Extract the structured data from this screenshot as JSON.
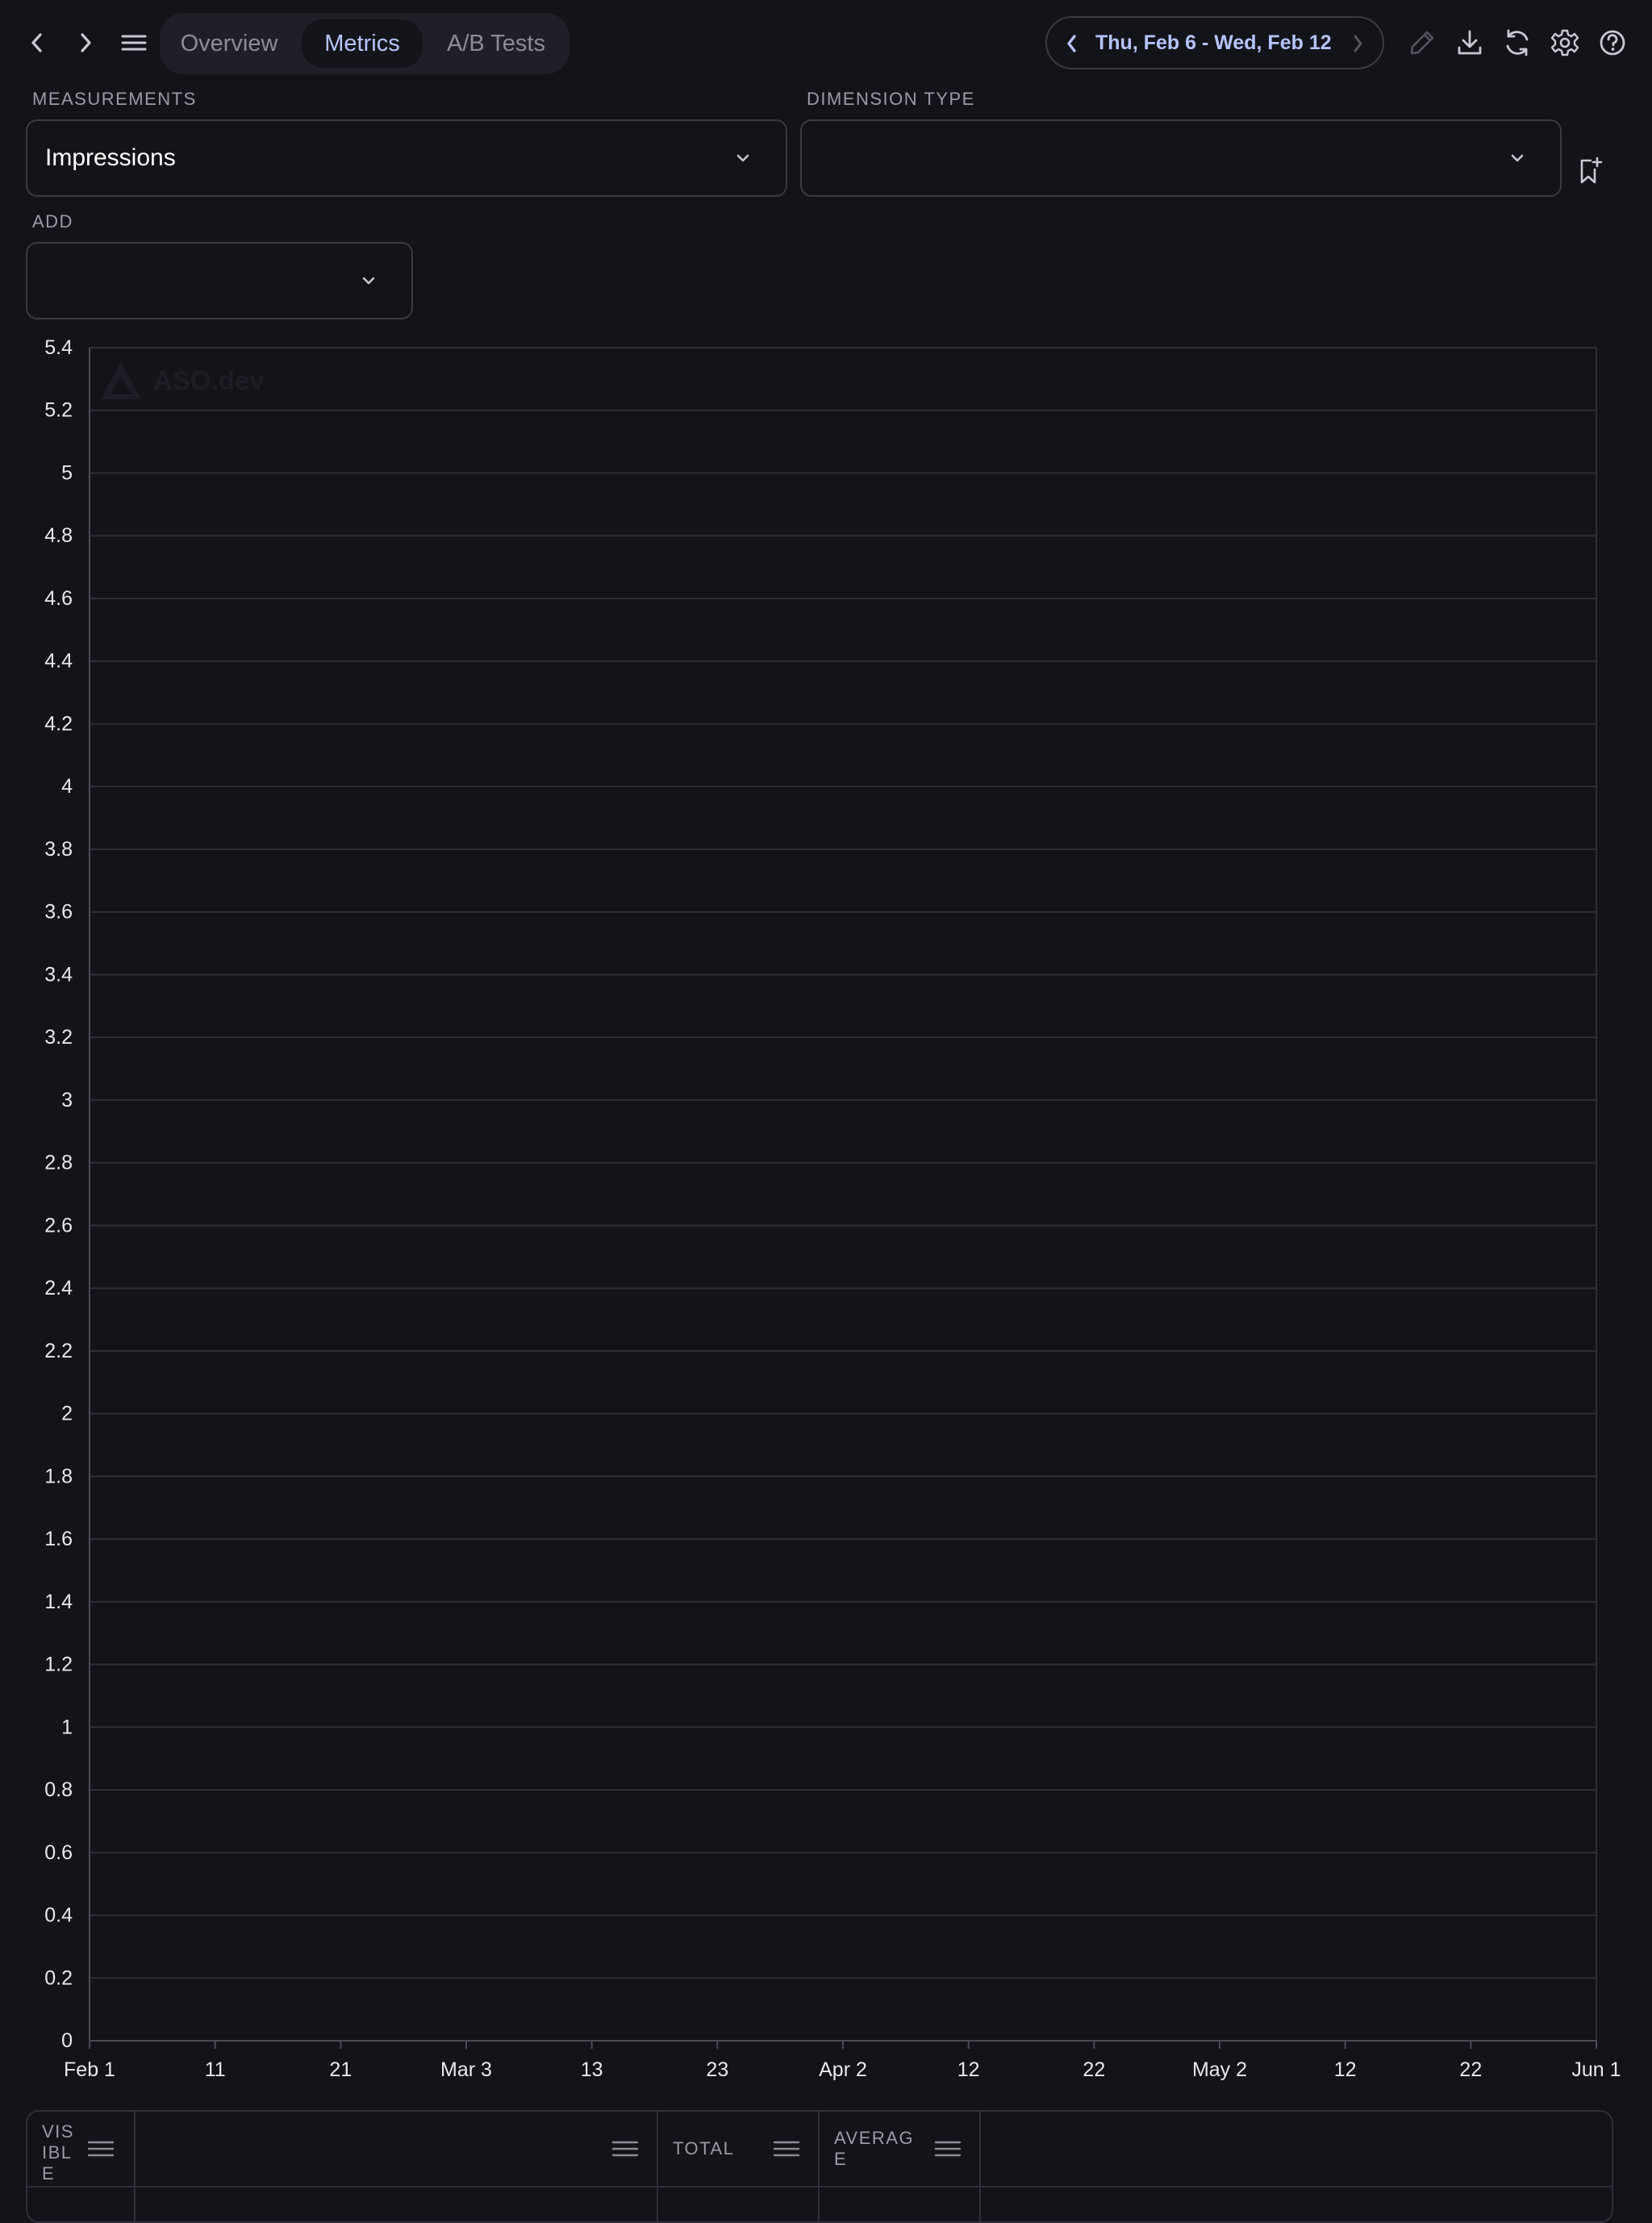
{
  "topbar": {
    "back_icon": "chevron-left-icon",
    "forward_icon": "chevron-right-icon",
    "menu_icon": "hamburger-icon",
    "tabs": [
      {
        "label": "Overview",
        "active": false
      },
      {
        "label": "Metrics",
        "active": true
      },
      {
        "label": "A/B Tests",
        "active": false
      }
    ],
    "date_range": "Thu, Feb 6 - Wed, Feb 12",
    "tools": [
      "pencil-icon",
      "download-icon",
      "refresh-icon",
      "gear-icon",
      "help-icon"
    ]
  },
  "filters": {
    "measurements": {
      "label": "MEASUREMENTS",
      "value": "Impressions"
    },
    "dimension_type": {
      "label": "DIMENSION TYPE",
      "value": ""
    },
    "add": {
      "label": "ADD",
      "value": ""
    },
    "bookmark_icon": "bookmark-add-icon"
  },
  "watermark": "ASO.dev",
  "chart_data": {
    "type": "line",
    "title": "",
    "xlabel": "",
    "ylabel": "",
    "series": [],
    "ylim": [
      0,
      5.4
    ],
    "y_ticks": [
      "0",
      "0.2",
      "0.4",
      "0.6",
      "0.8",
      "1",
      "1.2",
      "1.4",
      "1.6",
      "1.8",
      "2",
      "2.2",
      "2.4",
      "2.6",
      "2.8",
      "3",
      "3.2",
      "3.4",
      "3.6",
      "3.8",
      "4",
      "4.2",
      "4.4",
      "4.6",
      "4.8",
      "5",
      "5.2",
      "5.4"
    ],
    "xlim": [
      "2025-02-01",
      "2025-06-01"
    ],
    "x_ticks": [
      {
        "label": "Feb 1",
        "date": "2025-02-01"
      },
      {
        "label": "11",
        "date": "2025-02-11"
      },
      {
        "label": "21",
        "date": "2025-02-21"
      },
      {
        "label": "Mar 3",
        "date": "2025-03-03"
      },
      {
        "label": "13",
        "date": "2025-03-13"
      },
      {
        "label": "23",
        "date": "2025-03-23"
      },
      {
        "label": "Apr 2",
        "date": "2025-04-02"
      },
      {
        "label": "12",
        "date": "2025-04-12"
      },
      {
        "label": "22",
        "date": "2025-04-22"
      },
      {
        "label": "May 2",
        "date": "2025-05-02"
      },
      {
        "label": "12",
        "date": "2025-05-12"
      },
      {
        "label": "22",
        "date": "2025-05-22"
      },
      {
        "label": "Jun 1",
        "date": "2025-06-01"
      }
    ],
    "grid": true,
    "colors": {
      "grid": "#2e2f38",
      "axis": "#4a4b55",
      "tick_text": "#e8e8ee"
    }
  },
  "table": {
    "columns": [
      {
        "label": "VIS\nIBL\nE"
      },
      {
        "label": ""
      },
      {
        "label": "TOTAL"
      },
      {
        "label": "AVERAG\nE"
      }
    ]
  }
}
